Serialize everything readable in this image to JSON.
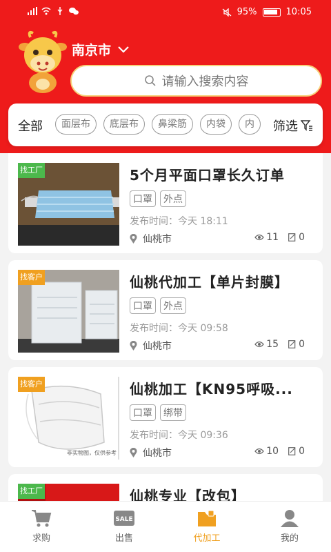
{
  "status_bar": {
    "battery": "95%",
    "time": "10:05"
  },
  "header": {
    "city": "南京市"
  },
  "search": {
    "placeholder": "请输入搜索内容"
  },
  "filters": {
    "all_label": "全部",
    "chips": [
      "面层布",
      "底层布",
      "鼻梁筋",
      "内袋",
      "内"
    ],
    "filter_label": "筛选"
  },
  "listings": [
    {
      "badge": "找工厂",
      "badge_color": "#4cb84c",
      "title": "5个月平面口罩长久订单",
      "tags": [
        "口罩",
        "外点"
      ],
      "time_label": "发布时间：",
      "time": "今天 18:11",
      "location": "仙桃市",
      "views": "11",
      "applies": "0"
    },
    {
      "badge": "找客户",
      "badge_color": "#f0a020",
      "title": "仙桃代加工【单片封膜】",
      "tags": [
        "口罩",
        "外点"
      ],
      "time_label": "发布时间：",
      "time": "今天 09:58",
      "location": "仙桃市",
      "views": "15",
      "applies": "0"
    },
    {
      "badge": "找客户",
      "badge_color": "#f0a020",
      "title": "仙桃加工【KN95呼吸...",
      "tags": [
        "口罩",
        "绑带"
      ],
      "time_label": "发布时间：",
      "time": "今天 09:36",
      "location": "仙桃市",
      "views": "10",
      "applies": "0",
      "image_caption": "非实物图，仅供参考"
    },
    {
      "badge": "找工厂",
      "badge_color": "#4cb84c",
      "title": "仙桃专业【改包】"
    }
  ],
  "tabbar": {
    "items": [
      {
        "label": "求购",
        "icon": "cart-icon"
      },
      {
        "label": "出售",
        "icon": "sale-icon"
      },
      {
        "label": "代加工",
        "icon": "folder-icon"
      },
      {
        "label": "我的",
        "icon": "user-icon"
      }
    ],
    "active_color": "#f0a020"
  },
  "colors": {
    "brand_red": "#ee1b1b",
    "accent_orange": "#f0a020",
    "badge_green": "#4cb84c"
  }
}
